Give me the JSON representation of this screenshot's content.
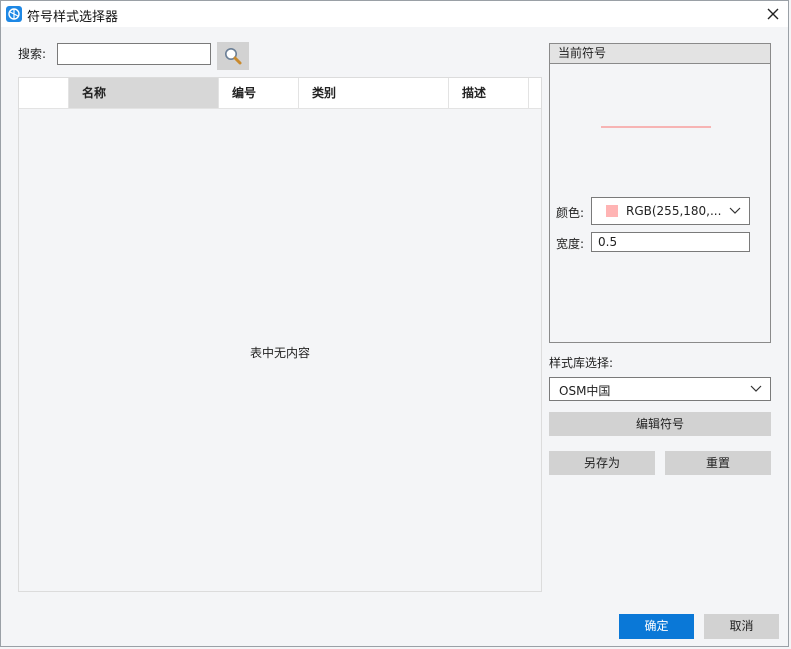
{
  "window": {
    "title": "符号样式选择器"
  },
  "search": {
    "label": "搜索:",
    "value": "",
    "placeholder": ""
  },
  "table": {
    "columns": [
      "名称",
      "编号",
      "类别",
      "描述"
    ],
    "rows": [],
    "empty_text": "表中无内容"
  },
  "preview": {
    "header": "当前符号",
    "line_color": "#f7b4b4",
    "color_label": "颜色:",
    "color_value": "RGB(255,180,...",
    "color_swatch": "#ffb4b4",
    "width_label": "宽度:",
    "width_value": "0.5"
  },
  "library": {
    "label": "样式库选择:",
    "selected": "OSM中国"
  },
  "buttons": {
    "edit_symbol": "编辑符号",
    "save_as": "另存为",
    "reset": "重置",
    "ok": "确定",
    "cancel": "取消"
  },
  "colors": {
    "accent": "#0a78d7",
    "button_gray": "#d2d2d2",
    "background": "#f4f5f7"
  }
}
